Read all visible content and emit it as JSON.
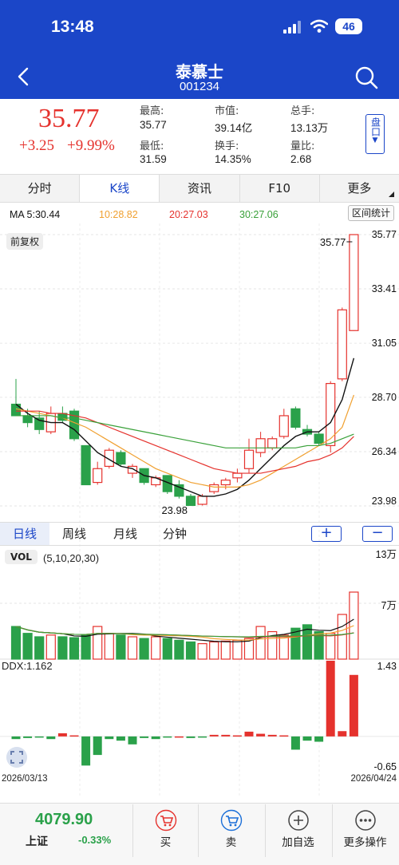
{
  "status_bar": {
    "time": "13:48",
    "battery": "46"
  },
  "nav": {
    "title": "泰慕士",
    "code": "001234"
  },
  "quote": {
    "price": "35.77",
    "change": "+3.25",
    "change_pct": "+9.99%",
    "stats": [
      {
        "label": "最高:",
        "value": "35.77"
      },
      {
        "label": "市值:",
        "value": "39.14亿"
      },
      {
        "label": "总手:",
        "value": "13.13万"
      },
      {
        "label": "最低:",
        "value": "31.59"
      },
      {
        "label": "换手:",
        "value": "14.35%"
      },
      {
        "label": "量比:",
        "value": "2.68"
      }
    ],
    "pankou": "盘口"
  },
  "tabs": [
    "分时",
    "K线",
    "资讯",
    "F10",
    "更多"
  ],
  "active_tab": "K线",
  "ma": {
    "ma5": "MA 5:30.44",
    "ma10": "10:28.82",
    "ma20": "20:27.03",
    "ma30": "30:27.06",
    "range_button": "区间统计"
  },
  "adjust_chip": "前复权",
  "periods": [
    "日线",
    "周线",
    "月线",
    "分钟"
  ],
  "zoom_in": "+",
  "zoom_out": "−",
  "volume": {
    "label": "VOL",
    "params": "(5,10,20,30)",
    "axis_top": "13万",
    "axis_mid": "7万"
  },
  "ddx": {
    "label": "DDX:1.162",
    "axis_top": "1.43",
    "axis_bottom": "-0.65"
  },
  "dates": {
    "start": "2026/03/13",
    "end": "2026/04/24"
  },
  "colors": {
    "up": "#e5322d",
    "down": "#2aa14a",
    "accent": "#1b46c8",
    "ma5": "#111111",
    "ma10": "#f0a030",
    "ma20": "#e5322d",
    "ma30": "#3aa13a"
  },
  "index": {
    "value": "4079.90",
    "name": "上证",
    "change": "-0.33%"
  },
  "actions": [
    "买",
    "卖",
    "加自选",
    "更多操作"
  ],
  "chart_data": {
    "type": "candlestick",
    "y_ticks": [
      "35.77",
      "33.41",
      "31.05",
      "28.70",
      "26.34",
      "23.98"
    ],
    "ylim": [
      23.98,
      35.77
    ],
    "high_label": "35.77",
    "low_label": "23.98",
    "candles": [
      {
        "o": 28.4,
        "h": 29.5,
        "l": 27.9,
        "c": 27.9
      },
      {
        "o": 27.9,
        "h": 28.2,
        "l": 27.4,
        "c": 27.6
      },
      {
        "o": 27.8,
        "h": 28.1,
        "l": 27.1,
        "c": 27.3
      },
      {
        "o": 27.2,
        "h": 28.3,
        "l": 27.1,
        "c": 28.0
      },
      {
        "o": 28.0,
        "h": 28.3,
        "l": 27.6,
        "c": 27.7
      },
      {
        "o": 28.1,
        "h": 28.2,
        "l": 26.8,
        "c": 26.9
      },
      {
        "o": 26.6,
        "h": 26.6,
        "l": 24.9,
        "c": 24.9
      },
      {
        "o": 25.0,
        "h": 25.9,
        "l": 24.9,
        "c": 25.6
      },
      {
        "o": 25.7,
        "h": 26.5,
        "l": 25.6,
        "c": 26.4
      },
      {
        "o": 26.3,
        "h": 26.4,
        "l": 25.7,
        "c": 25.8
      },
      {
        "o": 25.4,
        "h": 25.8,
        "l": 25.2,
        "c": 25.7
      },
      {
        "o": 25.6,
        "h": 25.6,
        "l": 24.9,
        "c": 25.0
      },
      {
        "o": 24.9,
        "h": 25.3,
        "l": 24.8,
        "c": 25.2
      },
      {
        "o": 25.3,
        "h": 25.3,
        "l": 24.5,
        "c": 24.6
      },
      {
        "o": 24.9,
        "h": 25.1,
        "l": 24.3,
        "c": 24.4
      },
      {
        "o": 24.4,
        "h": 24.5,
        "l": 23.98,
        "c": 24.0
      },
      {
        "o": 24.05,
        "h": 24.5,
        "l": 24.0,
        "c": 24.4
      },
      {
        "o": 24.6,
        "h": 25.0,
        "l": 24.5,
        "c": 24.9
      },
      {
        "o": 24.9,
        "h": 25.2,
        "l": 24.7,
        "c": 25.1
      },
      {
        "o": 25.2,
        "h": 25.6,
        "l": 25.0,
        "c": 25.4
      },
      {
        "o": 25.6,
        "h": 26.9,
        "l": 25.4,
        "c": 26.4
      },
      {
        "o": 26.3,
        "h": 27.2,
        "l": 26.1,
        "c": 26.9
      },
      {
        "o": 26.5,
        "h": 27.0,
        "l": 26.4,
        "c": 26.9
      },
      {
        "o": 27.0,
        "h": 28.2,
        "l": 26.9,
        "c": 27.9
      },
      {
        "o": 28.2,
        "h": 28.3,
        "l": 27.3,
        "c": 27.4
      },
      {
        "o": 27.3,
        "h": 27.5,
        "l": 27.0,
        "c": 27.1
      },
      {
        "o": 27.1,
        "h": 27.2,
        "l": 26.6,
        "c": 26.7
      },
      {
        "o": 26.6,
        "h": 29.4,
        "l": 26.3,
        "c": 29.3
      },
      {
        "o": 29.5,
        "h": 32.6,
        "l": 29.4,
        "c": 32.5
      },
      {
        "o": 31.6,
        "h": 35.77,
        "l": 31.59,
        "c": 35.77
      }
    ],
    "ma5": [
      28.4,
      28.0,
      27.7,
      27.6,
      27.6,
      27.3,
      26.8,
      26.3,
      26.0,
      25.7,
      25.6,
      25.3,
      25.2,
      25.0,
      24.8,
      24.6,
      24.4,
      24.4,
      24.5,
      24.7,
      25.1,
      25.6,
      26.1,
      26.6,
      27.0,
      27.2,
      27.2,
      27.6,
      28.6,
      30.4
    ],
    "ma10": [
      28.2,
      28.1,
      28.0,
      27.9,
      27.8,
      27.6,
      27.4,
      27.1,
      26.8,
      26.5,
      26.2,
      25.9,
      25.6,
      25.4,
      25.2,
      25.0,
      24.9,
      24.8,
      24.8,
      24.8,
      24.9,
      25.1,
      25.4,
      25.7,
      26.0,
      26.3,
      26.6,
      26.9,
      27.4,
      28.8
    ],
    "ma20": [
      28.1,
      28.1,
      28.1,
      28.0,
      28.0,
      27.9,
      27.8,
      27.6,
      27.4,
      27.2,
      27.0,
      26.8,
      26.6,
      26.4,
      26.2,
      26.0,
      25.8,
      25.6,
      25.5,
      25.4,
      25.4,
      25.4,
      25.5,
      25.6,
      25.7,
      25.9,
      26.0,
      26.2,
      26.5,
      27.0
    ],
    "ma30": [
      27.9,
      27.9,
      27.9,
      27.9,
      27.8,
      27.8,
      27.7,
      27.6,
      27.5,
      27.4,
      27.3,
      27.2,
      27.1,
      27.0,
      26.9,
      26.8,
      26.7,
      26.6,
      26.5,
      26.5,
      26.5,
      26.5,
      26.5,
      26.5,
      26.5,
      26.6,
      26.6,
      26.7,
      26.9,
      27.1
    ],
    "volume_max": 130000,
    "volume": [
      38000,
      30000,
      26000,
      28000,
      26000,
      25000,
      28000,
      38000,
      30000,
      28000,
      26000,
      24000,
      26000,
      24000,
      22000,
      20000,
      18000,
      20000,
      21000,
      22000,
      24000,
      38000,
      32000,
      28000,
      36000,
      40000,
      32000,
      30000,
      52000,
      78000,
      130000
    ],
    "ddx_range": [
      -0.65,
      1.43
    ],
    "ddx": [
      -0.05,
      -0.03,
      -0.02,
      -0.05,
      0.06,
      0.02,
      -0.55,
      -0.35,
      -0.05,
      -0.08,
      -0.15,
      -0.03,
      -0.05,
      -0.02,
      0.0,
      -0.03,
      -0.02,
      0.03,
      0.03,
      0.02,
      0.09,
      0.05,
      0.03,
      0.02,
      -0.25,
      -0.08,
      -0.1,
      1.43,
      0.1,
      1.162
    ]
  }
}
